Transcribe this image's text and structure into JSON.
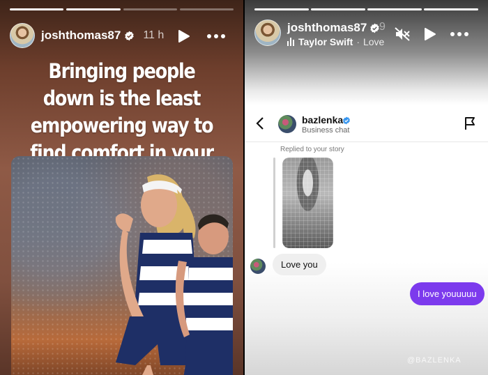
{
  "left_story": {
    "username": "joshthomas87",
    "time": "11 h",
    "headline": "Bringing people down is the least empowering way to find comfort in your queerness"
  },
  "right_story": {
    "username": "joshthomas87",
    "time_partial": "9",
    "song_title": "Taylor Swift",
    "song_separator": "·",
    "song_artist": "Love",
    "chat": {
      "name": "bazlenka",
      "subtitle": "Business chat",
      "reply_label": "Replied to your story",
      "incoming_message": "Love you",
      "outgoing_message": "I love youuuuu"
    },
    "watermark": "@BAZLENKA"
  },
  "colors": {
    "outgoing_bubble": "#7c3aed",
    "verified_badge": "#3897f0"
  },
  "icons": {
    "left_play": "play-icon",
    "left_more": "more-horizontal-icon",
    "right_mute": "speaker-muted-icon",
    "right_play": "play-icon",
    "right_more": "more-horizontal-icon",
    "back": "chevron-left-icon",
    "report": "flag-icon",
    "verified": "verified-badge-icon"
  },
  "progress": {
    "left_segments": [
      1.0,
      1.0,
      0.0,
      0.0
    ],
    "right_segments": [
      1.0,
      1.0,
      1.0,
      1.0
    ]
  }
}
